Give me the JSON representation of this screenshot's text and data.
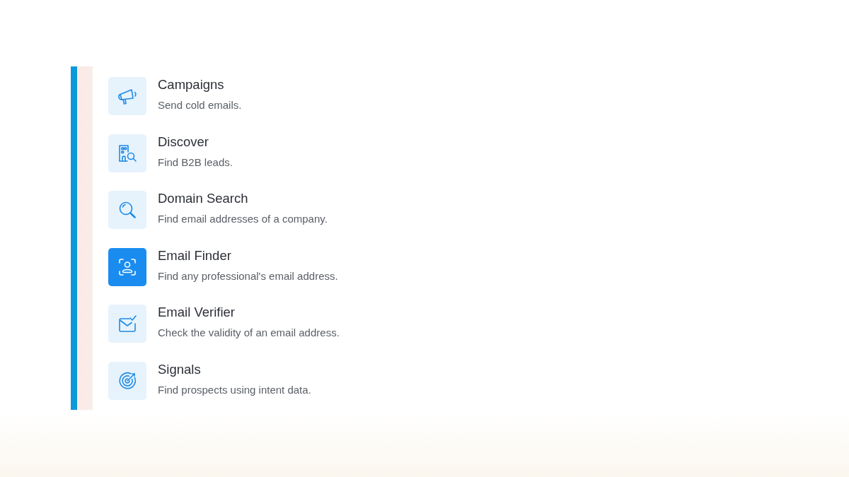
{
  "menu": {
    "items": [
      {
        "title": "Campaigns",
        "description": "Send cold emails.",
        "selected": false
      },
      {
        "title": "Discover",
        "description": "Find B2B leads.",
        "selected": false
      },
      {
        "title": "Domain Search",
        "description": "Find email addresses of a company.",
        "selected": false
      },
      {
        "title": "Email Finder",
        "description": "Find any professional's email address.",
        "selected": true
      },
      {
        "title": "Email Verifier",
        "description": "Check the validity of an email address.",
        "selected": false
      },
      {
        "title": "Signals",
        "description": "Find prospects using intent data.",
        "selected": false
      }
    ]
  }
}
